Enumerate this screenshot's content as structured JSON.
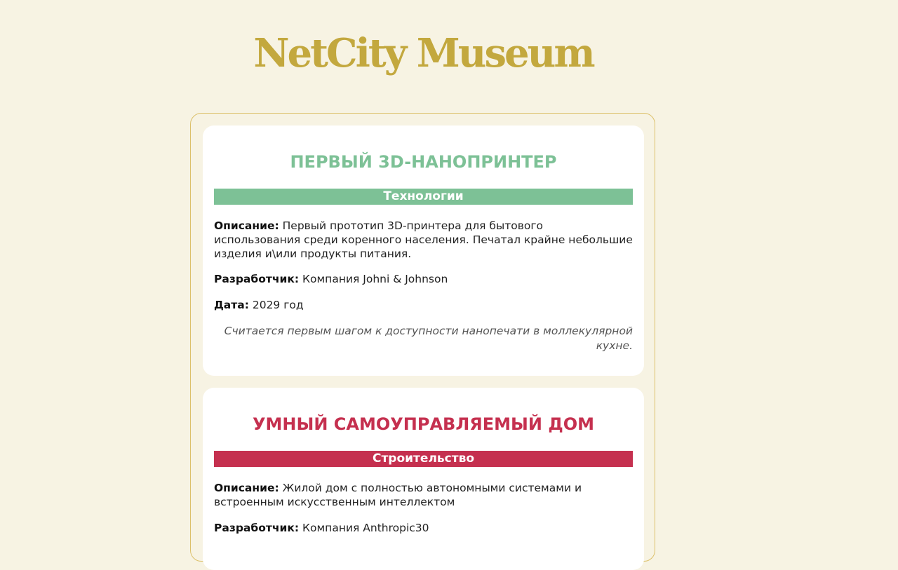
{
  "site": {
    "logo_text": "NetCity Museum",
    "brand_color": "#c3a83e",
    "background_color": "#f7f3e3"
  },
  "exhibits": [
    {
      "title": "ПЕРВЫЙ 3D-НАНОПРИНТЕР",
      "category": "Технологии",
      "accent_color": "#7dc196",
      "description_label": "Описание:",
      "description": "Первый прототип 3D-принтера для бытового использования среди коренного населения. Печатал крайне небольшие изделия и\\или продукты питания.",
      "developer_label": "Разработчик:",
      "developer": "Компания Johni & Johnson",
      "date_label": "Дата:",
      "date": "2029 год",
      "note": "Считается первым шагом к доступности нанопечати в моллекулярной кухне."
    },
    {
      "title": "УМНЫЙ САМОУПРАВЛЯЕМЫЙ ДОМ",
      "category": "Строительство",
      "accent_color": "#c5304f",
      "description_label": "Описание:",
      "description": "Жилой дом с полностью автономными системами и встроенным искусственным интеллектом",
      "developer_label": "Разработчик:",
      "developer": "Компания Anthropic30"
    }
  ]
}
